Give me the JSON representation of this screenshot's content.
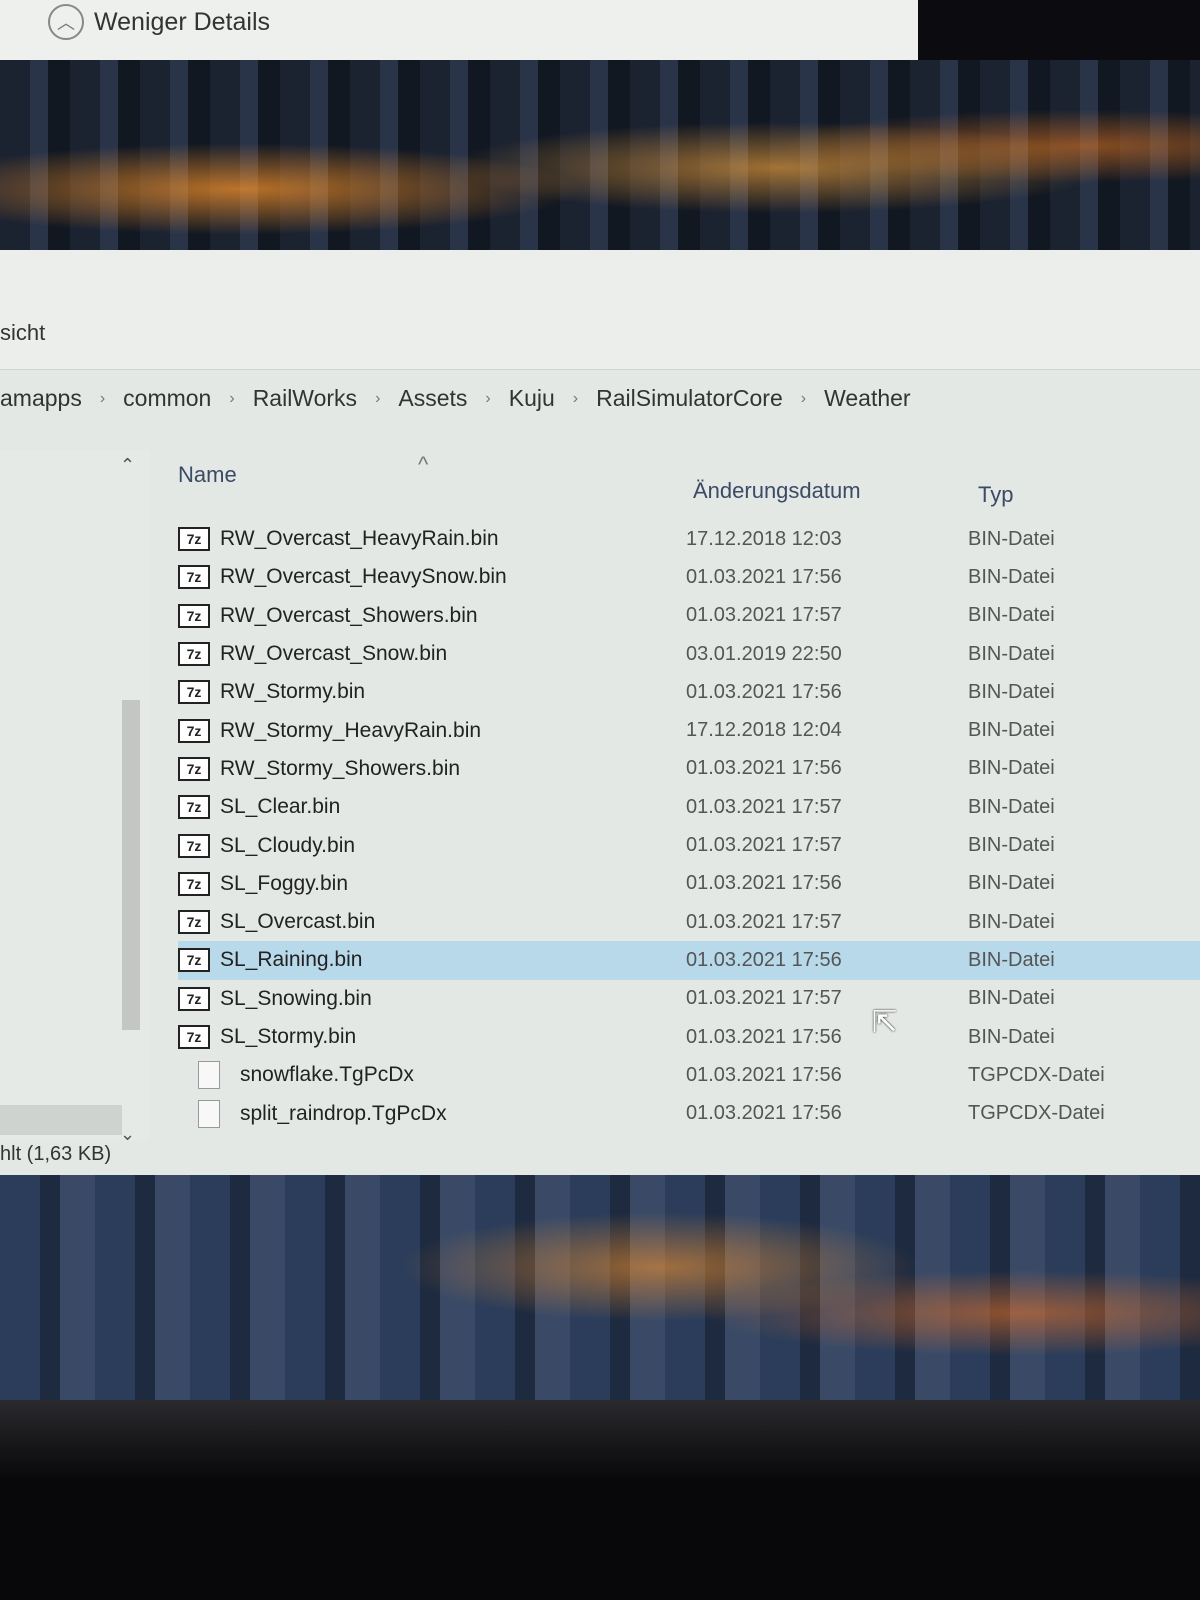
{
  "dialog": {
    "less_details_label": "Weniger Details"
  },
  "ribbon": {
    "tab_label": "sicht"
  },
  "breadcrumb": [
    "amapps",
    "common",
    "RailWorks",
    "Assets",
    "Kuju",
    "RailSimulatorCore",
    "Weather"
  ],
  "columns": {
    "name": "Name",
    "date": "Änderungsdatum",
    "type": "Typ"
  },
  "files": [
    {
      "name": "RW_Overcast_HeavyRain.bin",
      "date": "17.12.2018 12:03",
      "type": "BIN-Datei",
      "icon": "7z-icon"
    },
    {
      "name": "RW_Overcast_HeavySnow.bin",
      "date": "01.03.2021 17:56",
      "type": "BIN-Datei",
      "icon": "7z-icon"
    },
    {
      "name": "RW_Overcast_Showers.bin",
      "date": "01.03.2021 17:57",
      "type": "BIN-Datei",
      "icon": "7z-icon"
    },
    {
      "name": "RW_Overcast_Snow.bin",
      "date": "03.01.2019 22:50",
      "type": "BIN-Datei",
      "icon": "7z-icon"
    },
    {
      "name": "RW_Stormy.bin",
      "date": "01.03.2021 17:56",
      "type": "BIN-Datei",
      "icon": "7z-icon"
    },
    {
      "name": "RW_Stormy_HeavyRain.bin",
      "date": "17.12.2018 12:04",
      "type": "BIN-Datei",
      "icon": "7z-icon"
    },
    {
      "name": "RW_Stormy_Showers.bin",
      "date": "01.03.2021 17:56",
      "type": "BIN-Datei",
      "icon": "7z-icon"
    },
    {
      "name": "SL_Clear.bin",
      "date": "01.03.2021 17:57",
      "type": "BIN-Datei",
      "icon": "7z-icon"
    },
    {
      "name": "SL_Cloudy.bin",
      "date": "01.03.2021 17:57",
      "type": "BIN-Datei",
      "icon": "7z-icon"
    },
    {
      "name": "SL_Foggy.bin",
      "date": "01.03.2021 17:56",
      "type": "BIN-Datei",
      "icon": "7z-icon"
    },
    {
      "name": "SL_Overcast.bin",
      "date": "01.03.2021 17:57",
      "type": "BIN-Datei",
      "icon": "7z-icon"
    },
    {
      "name": "SL_Raining.bin",
      "date": "01.03.2021 17:56",
      "type": "BIN-Datei",
      "icon": "7z-icon",
      "selected": true
    },
    {
      "name": "SL_Snowing.bin",
      "date": "01.03.2021 17:57",
      "type": "BIN-Datei",
      "icon": "7z-icon"
    },
    {
      "name": "SL_Stormy.bin",
      "date": "01.03.2021 17:56",
      "type": "BIN-Datei",
      "icon": "7z-icon"
    },
    {
      "name": "snowflake.TgPcDx",
      "date": "01.03.2021 17:56",
      "type": "TGPCDX-Datei",
      "icon": "file-icon"
    },
    {
      "name": "split_raindrop.TgPcDx",
      "date": "01.03.2021 17:56",
      "type": "TGPCDX-Datei",
      "icon": "file-icon"
    }
  ],
  "icon_text": "7z",
  "status": "hlt (1,63 KB)",
  "colors": {
    "selected": "#b8d9ea",
    "header": "#3c4a66"
  }
}
